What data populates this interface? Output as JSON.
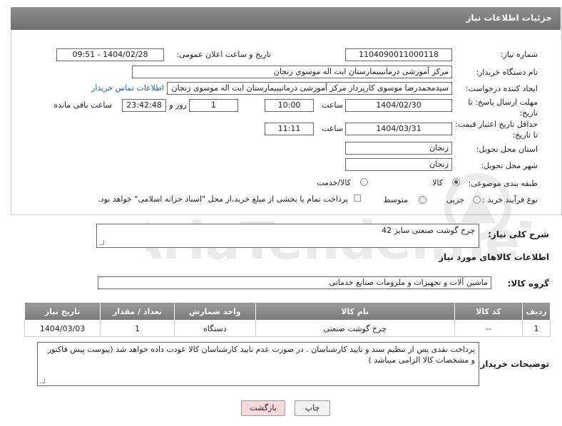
{
  "header": {
    "title": "جزئیات اطلاعات نیاز"
  },
  "form": {
    "need_number_label": "شماره نیاز:",
    "need_number": "1104090011000118",
    "announce_label": "تاریخ و ساعت اعلان عمومی:",
    "announce_value": "1404/02/28 - 09:51",
    "buyer_org_label": "نام دستگاه خریدار:",
    "buyer_org": "مرکز آموزشی درمانیبیمارستان ایت اله موسوی زنجان",
    "creator_label": "ایجاد کننده درخواست:",
    "creator": "سیدمحمدرضا موسوی کارپرداز مرکز آموزشی درمانیبیمارستان ایت اله موسوی زنجان",
    "contact_link": "اطلاعات تماس خریدار",
    "deadline_label_1": "مهلت ارسال پاسخ: تا",
    "deadline_label_2": "تاریخ:",
    "deadline_date": "1404/02/30",
    "time_label": "ساعت",
    "deadline_time": "10:00",
    "days_value": "1",
    "days_label": "روز و",
    "remaining_time": "23:42:48",
    "remaining_label": "ساعت باقی مانده",
    "price_label_1": "حداقل تاریخ اعتبار قیمت:",
    "price_label_2": "تا تاریخ:",
    "price_date": "1404/03/31",
    "price_time": "11:11",
    "province_label": "استان محل تحویل:",
    "province": "زنجان",
    "city_label": "شهر محل تحویل:",
    "city": "زنجان",
    "category_label": "طبقه بندی موضوعی:",
    "category_options": [
      "کالا",
      "کالا/خدمت"
    ],
    "purchase_label": "نوع فرآیند خرید :",
    "purchase_options": [
      "جزیی",
      "متوسط"
    ],
    "payment_note": "پرداخت تمام یا بخشی از مبلغ خرید،از محل \"اسناد خزانه اسلامی\" خواهد بود."
  },
  "summary": {
    "label": "شرح کلی نیاز:",
    "value": "چرخ گوشت صنعتی سایز 42"
  },
  "goods_section": {
    "title": "اطلاعات کالاهای مورد نیاز",
    "group_label": "گروه کالا:",
    "group_value": "ماشین آلات و تجهیزات و ملزومات صنایع خدماتی"
  },
  "table": {
    "headers": [
      "ردیف",
      "کد کالا",
      "نام کالا",
      "واحد شمارش",
      "تعداد / مقدار",
      "تاریخ نیاز"
    ],
    "rows": [
      [
        "1",
        "--",
        "چرخ گوشت صنعتی",
        "دستگاه",
        "1",
        "1404/03/03"
      ]
    ]
  },
  "buyer_notes": {
    "label": "توضیحات خریدار:",
    "value": "پرداخت نقدی پس از تنظیم سند و تایید کارشناسان . در صورت عدم تایید کارشناسان کالا عودت داده خواهد شد (پیوست پیش فاکتور و مشخصات کالا الزامی میباشد )"
  },
  "buttons": {
    "print": "چاپ",
    "back": "بازگشت"
  },
  "watermark": {
    "text": "AriaTender.neT"
  },
  "colors": {
    "header": "#7f7f7f",
    "link": "#1f5fbf",
    "back_button": "#f7d9d9"
  }
}
